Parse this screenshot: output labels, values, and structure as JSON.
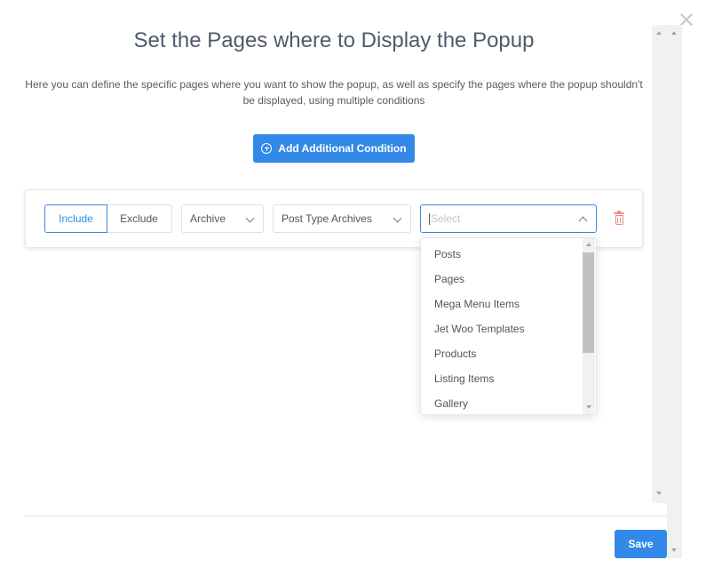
{
  "dialog": {
    "title": "Set the Pages where to Display the Popup",
    "description": "Here you can define the specific pages where you want to show the popup, as well as specify the pages where the popup shouldn't be displayed, using multiple conditions"
  },
  "actions": {
    "add_condition_label": "Add Additional Condition",
    "save_label": "Save"
  },
  "condition": {
    "mode_options": [
      "Include",
      "Exclude"
    ],
    "mode_selected": "Include",
    "type_value": "Archive",
    "subtype_value": "Post Type Archives",
    "target_placeholder": "Select"
  },
  "dropdown": {
    "options": [
      "Posts",
      "Pages",
      "Mega Menu Items",
      "Jet Woo Templates",
      "Products",
      "Listing Items",
      "Gallery"
    ]
  },
  "colors": {
    "accent": "#3389e8",
    "delete": "#f08c7e",
    "title": "#4f5a6b"
  },
  "icons": {
    "close": "close-icon",
    "add": "plus-circle-icon",
    "delete": "trash-icon",
    "expand": "chevron-down-icon",
    "collapse": "chevron-up-icon"
  }
}
